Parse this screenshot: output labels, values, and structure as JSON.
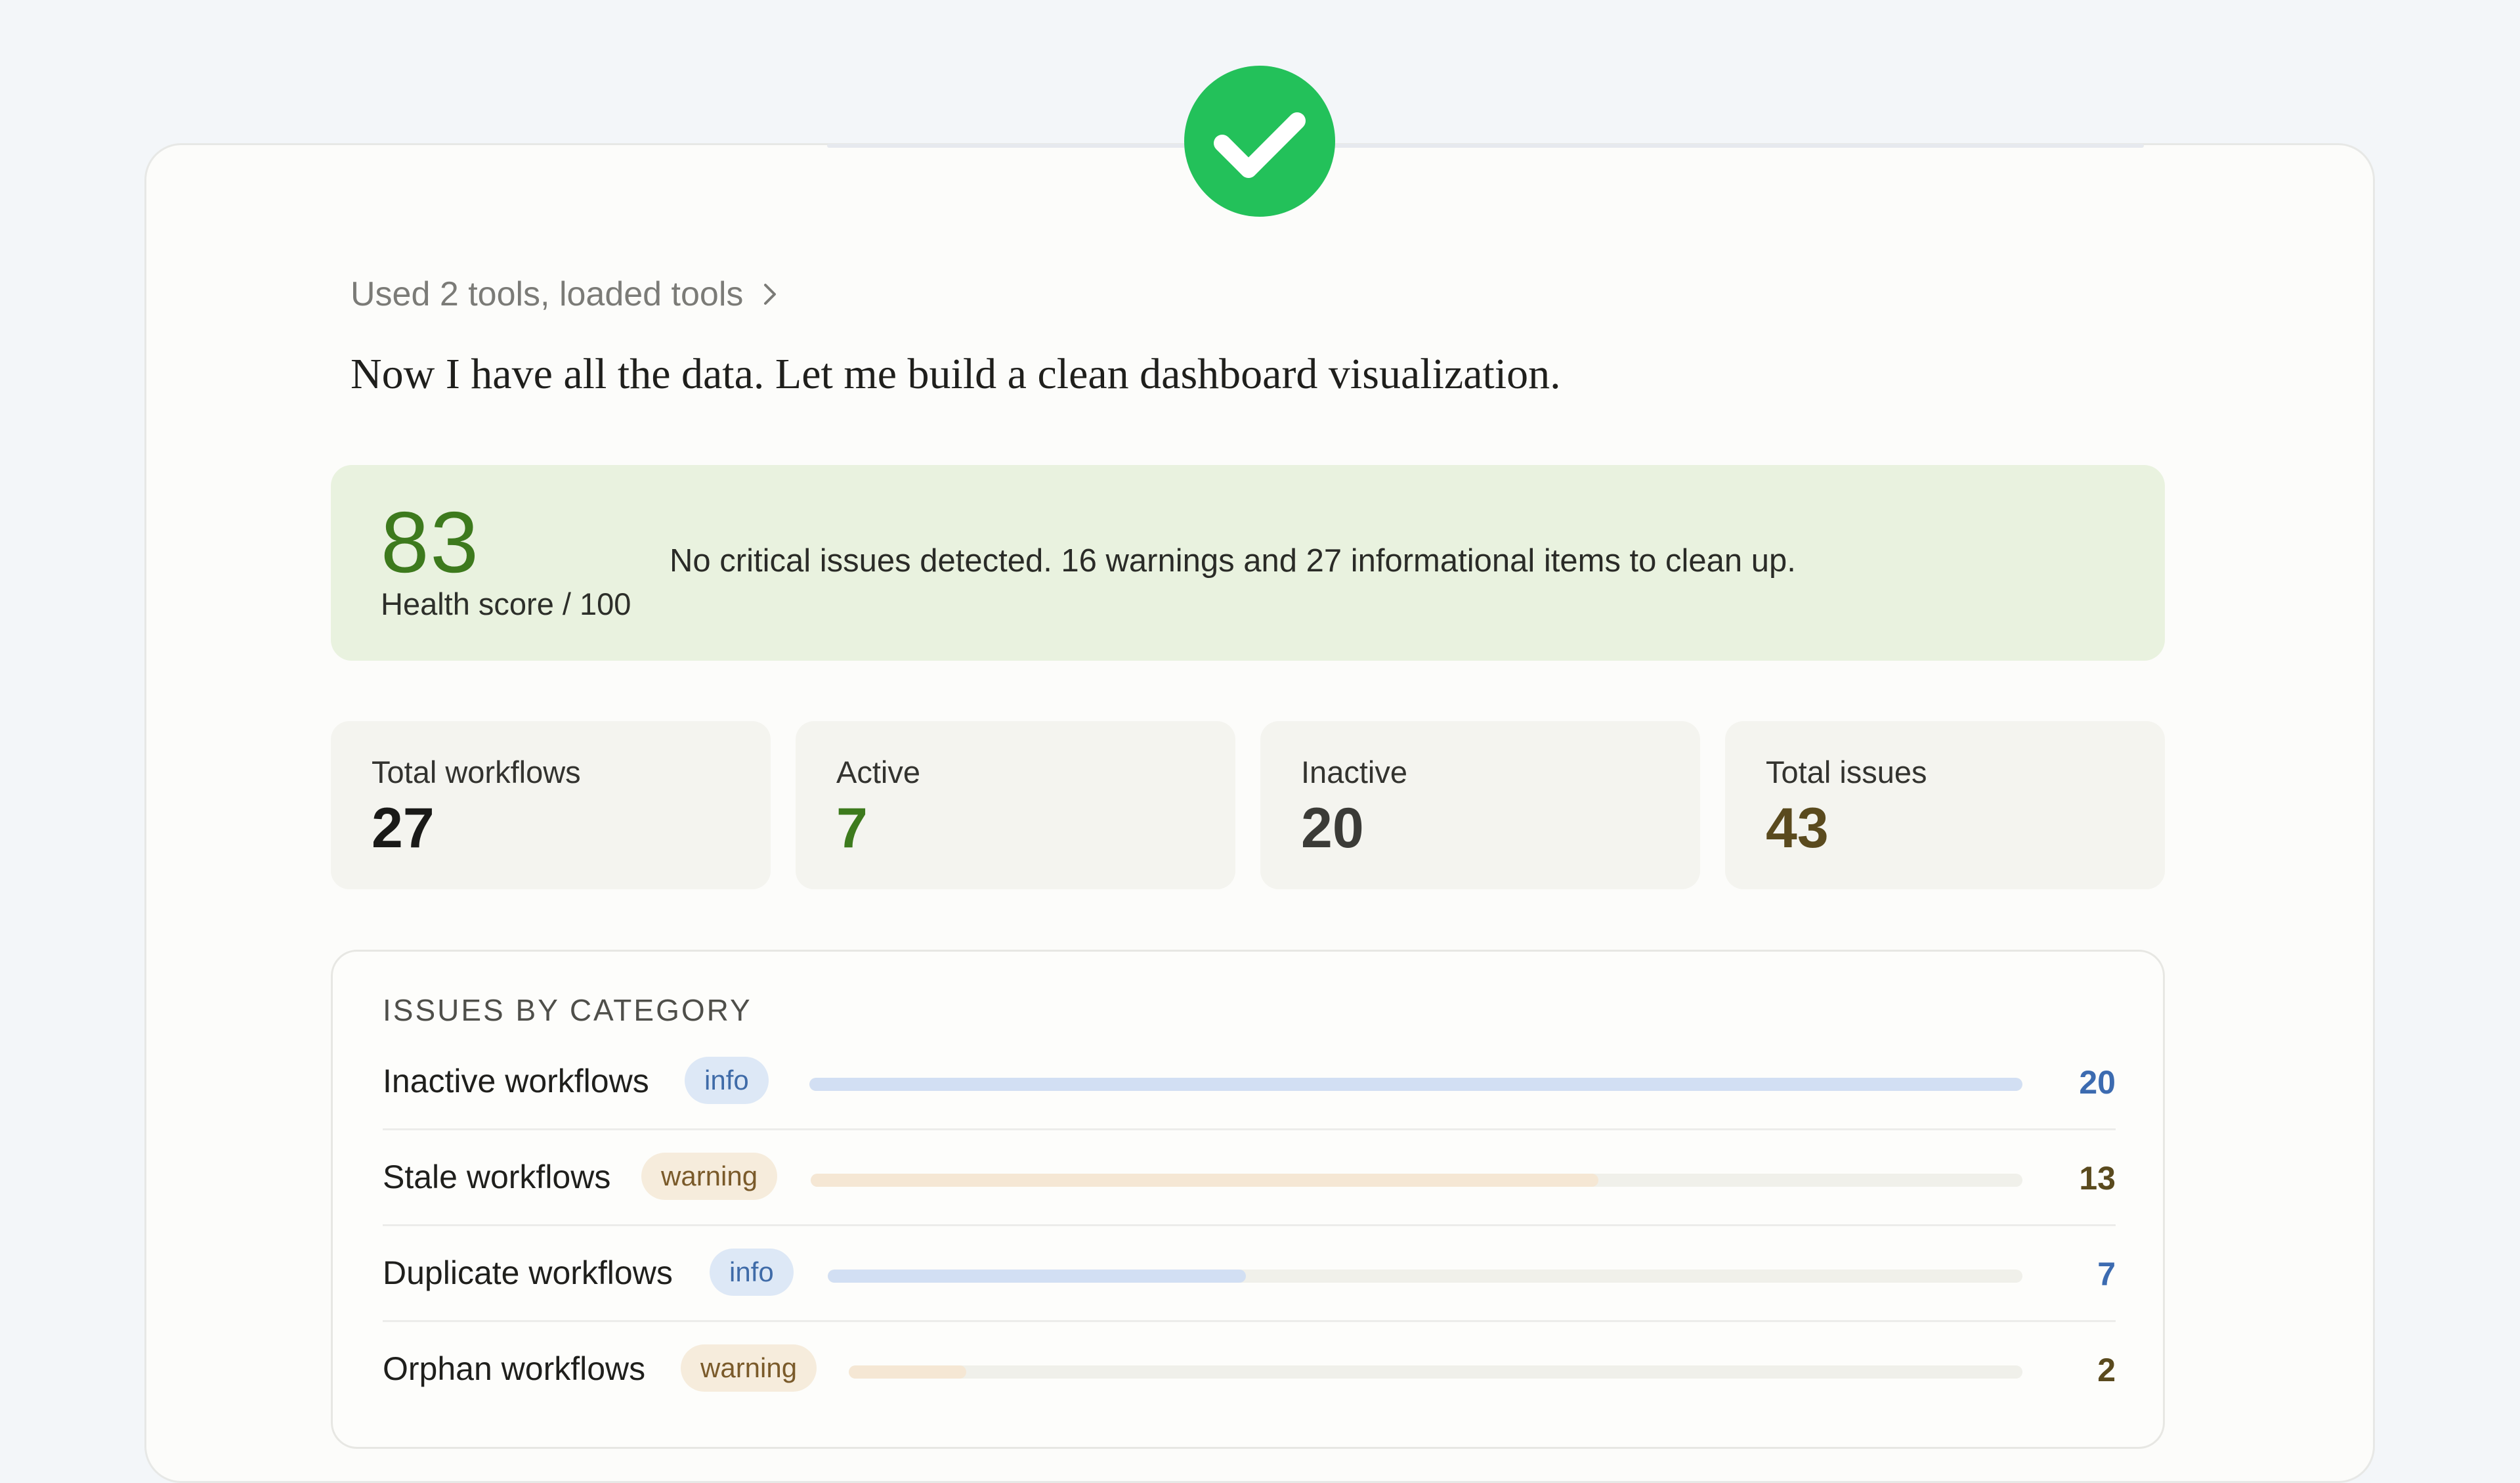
{
  "colors": {
    "success": "#23c15a",
    "health_bg": "#e9f2df",
    "health_score": "#3d7a1d",
    "active_value": "#3d7a1d",
    "issues_value": "#5a4a1e",
    "info": "#3c6bb0",
    "warning": "#7a5a2a"
  },
  "status_icon": "check-circle-icon",
  "tools_summary": {
    "text": "Used 2 tools, loaded tools",
    "icon": "chevron-right-icon"
  },
  "lead_text": "Now I have all the data. Let me build a clean dashboard visualization.",
  "health": {
    "score": "83",
    "label": "Health score / 100",
    "description": "No critical issues detected. 16 warnings and 27 informational items to clean up."
  },
  "stats": [
    {
      "label": "Total workflows",
      "value": "27"
    },
    {
      "label": "Active",
      "value": "7"
    },
    {
      "label": "Inactive",
      "value": "20"
    },
    {
      "label": "Total issues",
      "value": "43"
    }
  ],
  "issues": {
    "title": "ISSUES BY CATEGORY",
    "max": 20,
    "items": [
      {
        "name": "Inactive workflows",
        "tag": "info",
        "count": "20",
        "value": 20
      },
      {
        "name": "Stale workflows",
        "tag": "warning",
        "count": "13",
        "value": 13
      },
      {
        "name": "Duplicate workflows",
        "tag": "info",
        "count": "7",
        "value": 7
      },
      {
        "name": "Orphan workflows",
        "tag": "warning",
        "count": "2",
        "value": 2
      }
    ]
  }
}
